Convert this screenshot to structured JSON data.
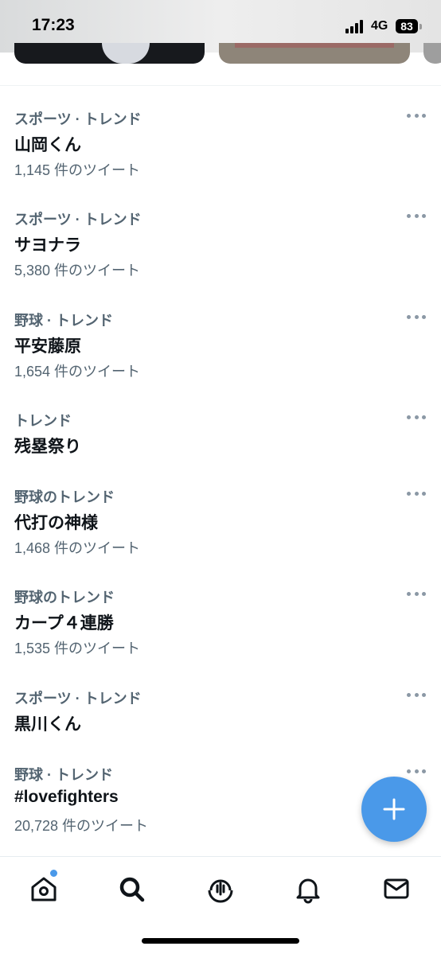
{
  "status_bar": {
    "time": "17:23",
    "network": "4G",
    "battery": "83"
  },
  "trends": [
    {
      "category": "スポーツ · トレンド",
      "title": "山岡くん",
      "count": "1,145 件のツイート"
    },
    {
      "category": "スポーツ · トレンド",
      "title": "サヨナラ",
      "count": "5,380 件のツイート"
    },
    {
      "category": "野球 · トレンド",
      "title": "平安藤原",
      "count": "1,654 件のツイート"
    },
    {
      "category": "トレンド",
      "title": "残塁祭り",
      "count": ""
    },
    {
      "category": "野球のトレンド",
      "title": "代打の神様",
      "count": "1,468 件のツイート"
    },
    {
      "category": "野球のトレンド",
      "title": "カープ４連勝",
      "count": "1,535 件のツイート"
    },
    {
      "category": "スポーツ · トレンド",
      "title": "黒川くん",
      "count": ""
    },
    {
      "category": "野球 · トレンド",
      "title": "#lovefighters",
      "count": "20,728 件のツイート"
    }
  ],
  "bottom_nav": {
    "items": [
      "home-icon",
      "search-icon",
      "spaces-icon",
      "notifications-icon",
      "messages-icon"
    ],
    "active": "search-icon",
    "home_badge": true
  },
  "fab": {
    "icon": "plus-icon"
  },
  "colors": {
    "accent": "#4a99e9",
    "text_primary": "#0f1419",
    "text_secondary": "#536471"
  }
}
